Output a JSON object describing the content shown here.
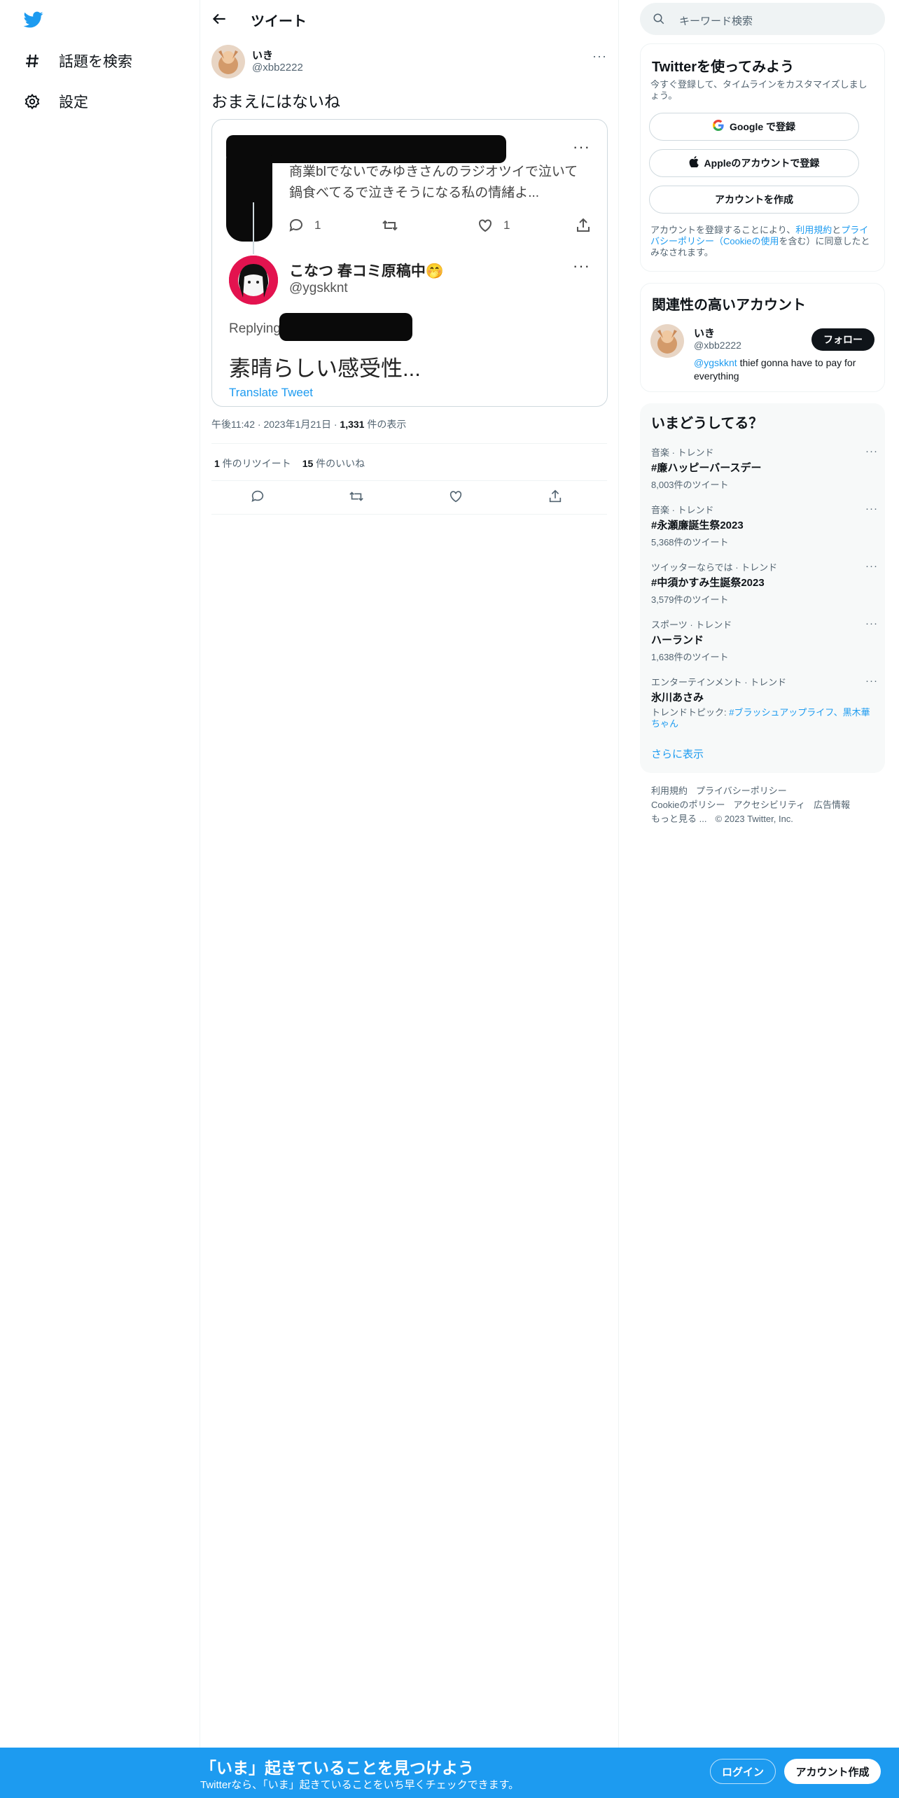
{
  "nav": {
    "explore_label": "話題を検索",
    "settings_label": "設定"
  },
  "header": {
    "title": "ツイート"
  },
  "tweet": {
    "author_name": "いき",
    "author_handle": "@xbb2222",
    "text": "おまえにはないね",
    "meta_time": "午後11:42",
    "meta_date": "2023年1月21日",
    "meta_views_count": "1,331",
    "meta_views_label": " 件の表示",
    "retweets_count": "1",
    "retweets_label": " 件のリツイート",
    "likes_count": "15",
    "likes_label": " 件のいいね"
  },
  "screenshot": {
    "quoted_text": "商業blでないでみゆきさんのラジオツイで泣いて鍋食べてるで泣きそうになる私の情緒よ...",
    "reply_count": "1",
    "like_count": "1",
    "reply_name": "こなつ 春コミ原稿中🤭",
    "reply_handle": "@ygskknt",
    "replying_label": "Replying",
    "reply_body": "素晴らしい感受性...",
    "translate_label": "Translate Tweet"
  },
  "search": {
    "placeholder": "キーワード検索"
  },
  "signup_panel": {
    "title": "Twitterを使ってみよう",
    "subtitle": "今すぐ登録して、タイムラインをカスタマイズしましょう。",
    "google_label": "Google で登録",
    "apple_label": "Appleのアカウントで登録",
    "create_label": "アカウントを作成",
    "terms_prefix": "アカウントを登録することにより、",
    "terms_link": "利用規約",
    "terms_and": "と",
    "privacy_link": "プライバシーポリシー",
    "terms_paren_open": "（",
    "cookie_link": "Cookieの使用",
    "terms_suffix": "を含む）に同意したとみなされます。"
  },
  "related_panel": {
    "title": "関連性の高いアカウント",
    "name": "いき",
    "handle": "@xbb2222",
    "follow_label": "フォロー",
    "bio_mention": "@ygskknt",
    "bio_text": " thief gonna have to pay for everything"
  },
  "trends_panel": {
    "title": "いまどうしてる？",
    "items": [
      {
        "category": "音楽 · トレンド",
        "name": "#廉ハッピーバースデー",
        "count": "8,003件のツイート"
      },
      {
        "category": "音楽 · トレンド",
        "name": "#永瀬廉誕生祭2023",
        "count": "5,368件のツイート"
      },
      {
        "category": "ツイッターならでは · トレンド",
        "name": "#中須かすみ生誕祭2023",
        "count": "3,579件のツイート"
      },
      {
        "category": "スポーツ · トレンド",
        "name": "ハーランド",
        "count": "1,638件のツイート"
      },
      {
        "category": "エンターテインメント · トレンド",
        "name": "氷川あさみ",
        "topic_prefix": "トレンドトピック: ",
        "topic_links": "#ブラッシュアップライフ、黒木華ちゃん"
      }
    ],
    "show_more": "さらに表示"
  },
  "footer": {
    "terms": "利用規約",
    "privacy": "プライバシーポリシー",
    "cookie": "Cookieのポリシー",
    "accessibility": "アクセシビリティ",
    "ads": "広告情報",
    "more": "もっと見る ...",
    "copyright": "© 2023 Twitter, Inc."
  },
  "bottom_bar": {
    "title": "「いま」起きていることを見つけよう",
    "subtitle": "Twitterなら、「いま」起きていることをいち早くチェックできます。",
    "login_label": "ログイン",
    "signup_label": "アカウント作成"
  },
  "colors": {
    "accent": "#1d9bf0",
    "text": "#0f1419",
    "muted": "#536471",
    "border": "#eff3f4",
    "trend_bg": "#f7f9f9"
  }
}
